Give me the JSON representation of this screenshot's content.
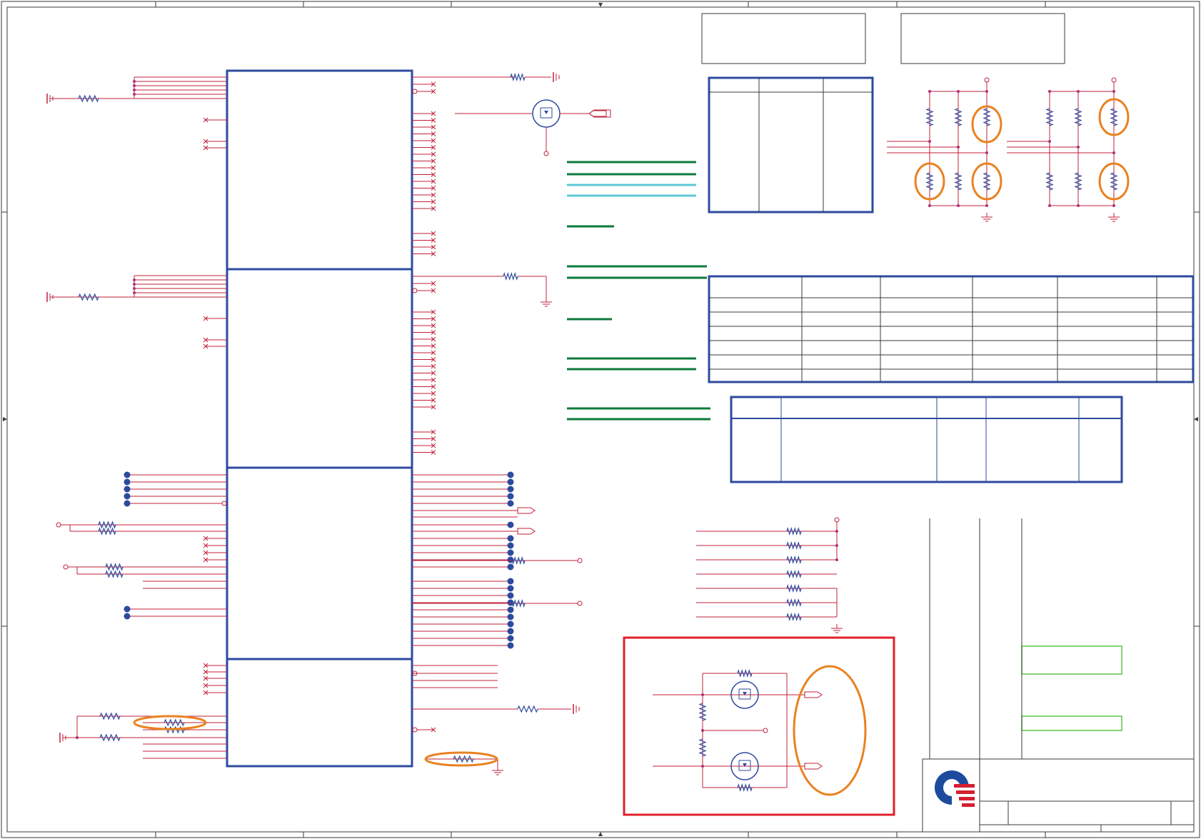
{
  "sheet": {
    "title": "",
    "notes": [],
    "border_color": "#3a3a3a"
  },
  "colors": {
    "net_wire": "#c0203a",
    "wire_pink": "#b0307a",
    "block_outline": "#2e4a9e",
    "via_dot": "#2e4a9e",
    "highlight_ring": "#e98220",
    "bus_green": "#0d7a3a",
    "bus_cyan": "#5cc9d4",
    "callout_box": "#e0202a",
    "light_green_box": "#5fc24a",
    "resistor": "#2e4a9e",
    "logo_blue": "#1e4a9e",
    "logo_red": "#d42030"
  },
  "blocks": [
    "ic-section-1",
    "ic-section-2",
    "ic-section-3",
    "ic-section-4"
  ],
  "tables": [
    "strap-table",
    "config-table",
    "option-table"
  ],
  "icons": [
    "ground-symbol",
    "chassis-ground-symbol",
    "resistor-symbol",
    "mosfet-symbol",
    "offpage-connector",
    "test-point",
    "company-logo-icon"
  ],
  "title_block": {
    "company": "",
    "sheet_title": "",
    "doc_number": "",
    "rev": ""
  }
}
